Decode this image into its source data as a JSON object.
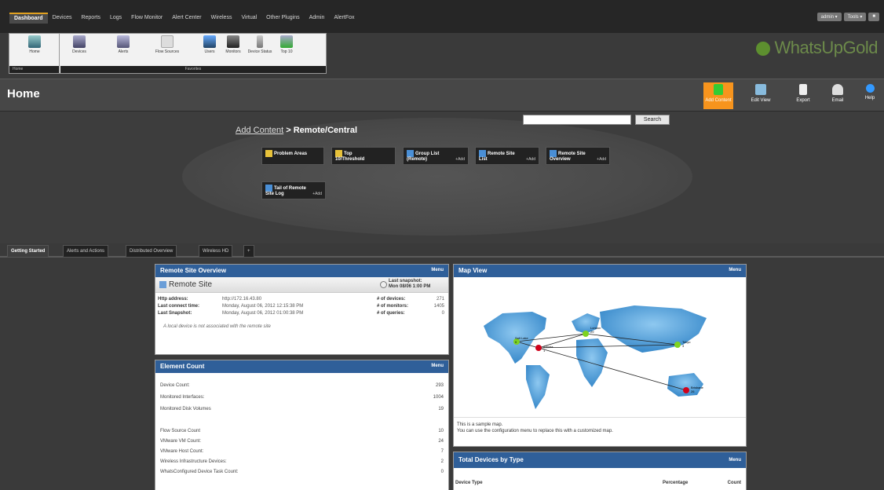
{
  "menu": {
    "items": [
      "Dashboard",
      "Devices",
      "Reports",
      "Logs",
      "Flow Monitor",
      "Alert Center",
      "Wireless",
      "Virtual",
      "Other Plugins",
      "Admin",
      "AlertFox"
    ],
    "active_index": 0
  },
  "user": {
    "name": "admin",
    "tools": "Tools"
  },
  "ribbon": {
    "home_group": {
      "button": "Home",
      "caption": "Home"
    },
    "favorites_group": {
      "buttons": [
        "Devices",
        "Alerts",
        "Flow Sources",
        "Users",
        "Monitors",
        "Device Status",
        "Top 10"
      ],
      "caption": "Favorites"
    }
  },
  "logo": {
    "text": "WhatsUpGold"
  },
  "page": {
    "title": "Home"
  },
  "toolbar": {
    "add_content": "Add Content",
    "edit_view": "Edit View",
    "export": "Export",
    "email": "Email",
    "help": "Help"
  },
  "add_content": {
    "breadcrumb_link": "Add Content",
    "breadcrumb_sep": " > ",
    "breadcrumb_current": "Remote/Central",
    "search_button": "Search",
    "add_label": "+Add",
    "cards": [
      {
        "line1": "Problem Areas",
        "line2": ""
      },
      {
        "line1": "Top",
        "line2": "10/Threshold"
      },
      {
        "line1": "Group List",
        "line2": "(Remote)"
      },
      {
        "line1": "Remote Site",
        "line2": "List"
      },
      {
        "line1": "Remote Site",
        "line2": "Overview"
      },
      {
        "line1": "Tail of Remote",
        "line2": "Site Log"
      }
    ]
  },
  "tabs": [
    "Getting Started",
    "Alerts and Actions",
    "Distributed Overview",
    "Wireless HD",
    "+"
  ],
  "remote_site": {
    "title": "Remote Site Overview",
    "menu": "Menu",
    "site_name": "Remote Site",
    "snapshot_label": "Last snapshot:",
    "snapshot_value": "Mon 08/06 1:00 PM",
    "fields": [
      {
        "label": "Http address:",
        "value": "http://172.16.43.80"
      },
      {
        "label": "Last connect time:",
        "value": "Monday, August 06, 2012 12:15:38 PM"
      },
      {
        "label": "Last Snapshot:",
        "value": "Monday, August 06, 2012 01:00:38 PM"
      }
    ],
    "stats": [
      {
        "label": "# of devices:",
        "value": "271"
      },
      {
        "label": "# of monitors:",
        "value": "1405"
      },
      {
        "label": "# of queries:",
        "value": "0"
      }
    ],
    "note": "A local device is not associated with the remote site"
  },
  "element_count": {
    "title": "Element Count",
    "menu": "Menu",
    "rows": [
      {
        "label": "Device Count:",
        "value": "293"
      },
      {
        "label": "Monitored Interfaces:",
        "value": "1004"
      },
      {
        "label": "Monitored Disk Volumes",
        "value": "19"
      },
      {
        "label": "",
        "value": ""
      },
      {
        "label": "Flow Source Count",
        "value": "10"
      },
      {
        "label": "VMware VM Count:",
        "value": "24"
      },
      {
        "label": "VMware Host Count:",
        "value": "7"
      },
      {
        "label": "Wireless Infrastructure Devices:",
        "value": "2"
      },
      {
        "label": "WhatsConfigured Device Task Count:",
        "value": "0"
      }
    ]
  },
  "map_view": {
    "title": "Map View",
    "menu": "Menu",
    "note_line1": "This is a sample map.",
    "note_line2": "You can use the configuration menu to replace this with a customized map.",
    "sites": [
      {
        "name": "Salt Lake",
        "count": "0",
        "status": "green"
      },
      {
        "name": "Atlanta",
        "count": "1",
        "status": "red"
      },
      {
        "name": "London",
        "count": "29",
        "status": "green"
      },
      {
        "name": "Tokyo",
        "count": "3",
        "status": "green"
      },
      {
        "name": "Brisbane",
        "count": "26",
        "status": "red"
      }
    ]
  },
  "total_devices": {
    "title": "Total Devices by Type",
    "menu": "Menu",
    "columns": [
      "Device Type",
      "Percentage",
      "Count"
    ]
  },
  "colors": {
    "accent": "#f7941d",
    "panel_header": "#2f5f99",
    "status_up": "#7ed321",
    "status_down": "#d0021b"
  }
}
